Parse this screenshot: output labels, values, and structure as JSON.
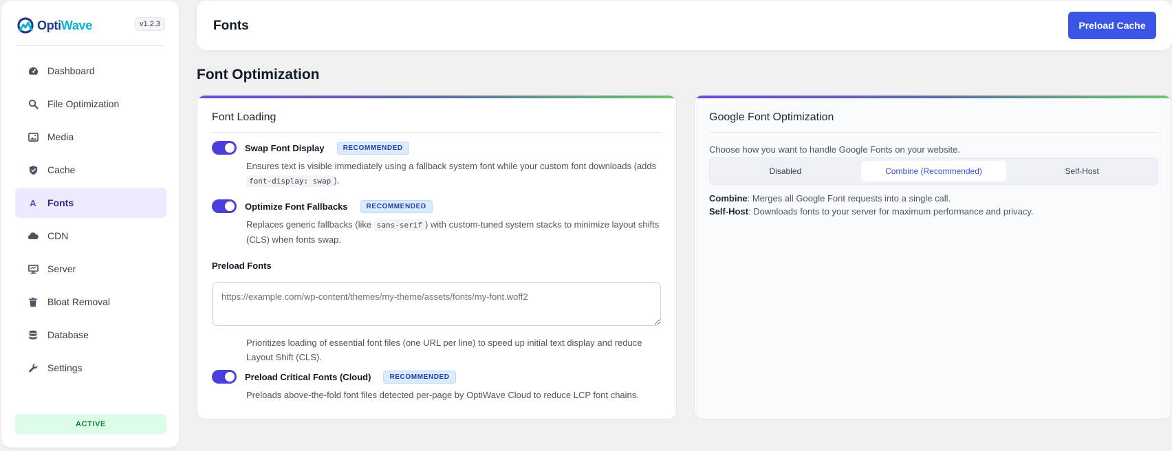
{
  "brand": {
    "name_part1": "Opti",
    "name_part2": "Wave",
    "version": "v1.2.3"
  },
  "sidebar": {
    "items": [
      {
        "label": "Dashboard",
        "icon": "dashboard-icon"
      },
      {
        "label": "File Optimization",
        "icon": "search-icon"
      },
      {
        "label": "Media",
        "icon": "image-icon"
      },
      {
        "label": "Cache",
        "icon": "shield-icon"
      },
      {
        "label": "Fonts",
        "icon": "font-icon",
        "glyph": "A"
      },
      {
        "label": "CDN",
        "icon": "cloud-icon"
      },
      {
        "label": "Server",
        "icon": "monitor-icon"
      },
      {
        "label": "Bloat Removal",
        "icon": "trash-icon"
      },
      {
        "label": "Database",
        "icon": "database-icon"
      },
      {
        "label": "Settings",
        "icon": "wrench-icon"
      }
    ],
    "active_item": "Fonts",
    "status": "ACTIVE"
  },
  "header": {
    "title": "Fonts",
    "button": "Preload Cache"
  },
  "section_title": "Font Optimization",
  "font_loading": {
    "title": "Font Loading",
    "options": [
      {
        "label": "Swap Font Display",
        "badge": "RECOMMENDED",
        "enabled": true,
        "desc_pre": "Ensures text is visible immediately using a fallback system font while your custom font downloads (adds ",
        "desc_code": "font-display: swap",
        "desc_post": ")."
      },
      {
        "label": "Optimize Font Fallbacks",
        "badge": "RECOMMENDED",
        "enabled": true,
        "desc_pre": "Replaces generic fallbacks (like ",
        "desc_code": "sans-serif",
        "desc_post": ") with custom-tuned system stacks to minimize layout shifts (CLS) when fonts swap."
      }
    ],
    "preload": {
      "label": "Preload Fonts",
      "placeholder": "https://example.com/wp-content/themes/my-theme/assets/fonts/my-font.woff2",
      "help": "Prioritizes loading of essential font files (one URL per line) to speed up initial text display and reduce Layout Shift (CLS)."
    },
    "critical": {
      "label": "Preload Critical Fonts (Cloud)",
      "badge": "RECOMMENDED",
      "enabled": true,
      "desc": "Preloads above-the-fold font files detected per-page by OptiWave Cloud to reduce LCP font chains."
    }
  },
  "google_fonts": {
    "title": "Google Font Optimization",
    "description": "Choose how you want to handle Google Fonts on your website.",
    "modes": [
      "Disabled",
      "Combine (Recommended)",
      "Self-Host"
    ],
    "selected_mode": "Combine (Recommended)",
    "notes": [
      {
        "term": "Combine",
        "text": ": Merges all Google Font requests into a single call."
      },
      {
        "term": "Self-Host",
        "text": ": Downloads fonts to your server for maximum performance and privacy."
      }
    ]
  },
  "colors": {
    "accent": "#3b55e6",
    "toggle": "#4b3fd9",
    "active_nav": "#ecebfd",
    "status_bg": "#dcfce7"
  }
}
